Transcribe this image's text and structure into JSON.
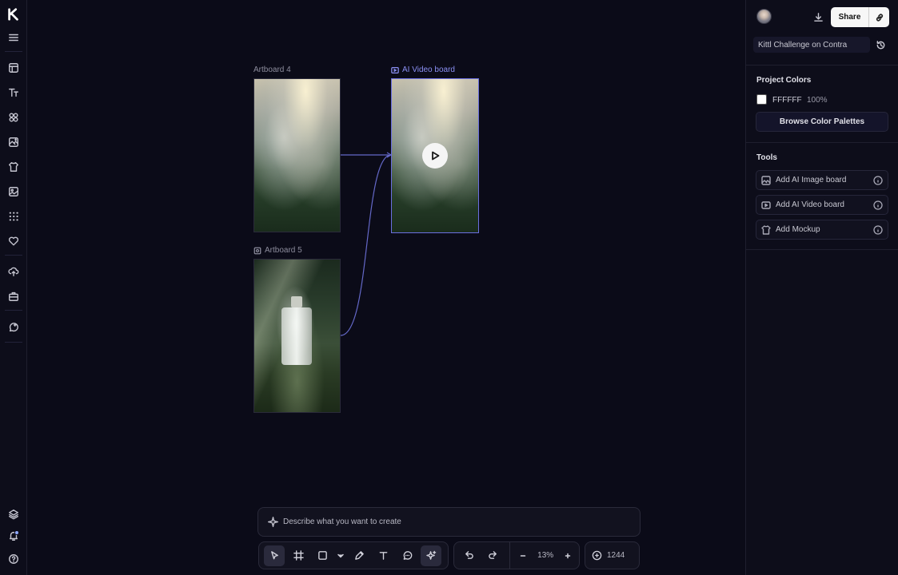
{
  "rail": {
    "items": [
      {
        "name": "kittl-logo-icon"
      },
      {
        "name": "menu-icon"
      },
      {
        "name": "templates-icon"
      },
      {
        "name": "text-icon"
      },
      {
        "name": "elements-icon"
      },
      {
        "name": "ai-image-icon"
      },
      {
        "name": "mockup-icon"
      },
      {
        "name": "images-icon"
      },
      {
        "name": "apps-icon"
      },
      {
        "name": "favorites-icon"
      },
      {
        "name": "upload-icon"
      },
      {
        "name": "brand-kit-icon"
      },
      {
        "name": "feedback-icon"
      },
      {
        "name": "layers-icon"
      },
      {
        "name": "notifications-icon"
      },
      {
        "name": "help-icon"
      }
    ]
  },
  "canvas": {
    "artboards": [
      {
        "label": "Artboard 4",
        "image": "forest-fog"
      },
      {
        "label": "AI Video board",
        "image": "forest-fog",
        "selected": true
      },
      {
        "label": "Artboard 5",
        "image": "perfume-bottle-forest"
      }
    ],
    "prompt_placeholder": "Describe what you want to create"
  },
  "toolbar": {
    "tools": [
      {
        "name": "select-tool-icon",
        "active": true
      },
      {
        "name": "frame-tool-icon"
      },
      {
        "name": "shape-tool-icon"
      },
      {
        "name": "shape-dropdown-chevron-icon"
      },
      {
        "name": "pen-tool-icon"
      },
      {
        "name": "text-tool-icon"
      },
      {
        "name": "comment-tool-icon"
      },
      {
        "name": "ai-tool-icon",
        "active": true
      }
    ],
    "zoom": "13%",
    "credits": "1244"
  },
  "panel": {
    "share_label": "Share",
    "project_name": "Kittl Challenge on Contra",
    "project_colors_title": "Project Colors",
    "color_hex": "FFFFFF",
    "color_opacity": "100%",
    "browse_label": "Browse Color Palettes",
    "tools_title": "Tools",
    "tools": [
      {
        "label": "Add AI Image board"
      },
      {
        "label": "Add AI Video board"
      },
      {
        "label": "Add Mockup"
      }
    ]
  },
  "colors": {
    "background": "#0b0b18",
    "accent": "#6a6fe0",
    "swatch": "#FFFFFF"
  }
}
